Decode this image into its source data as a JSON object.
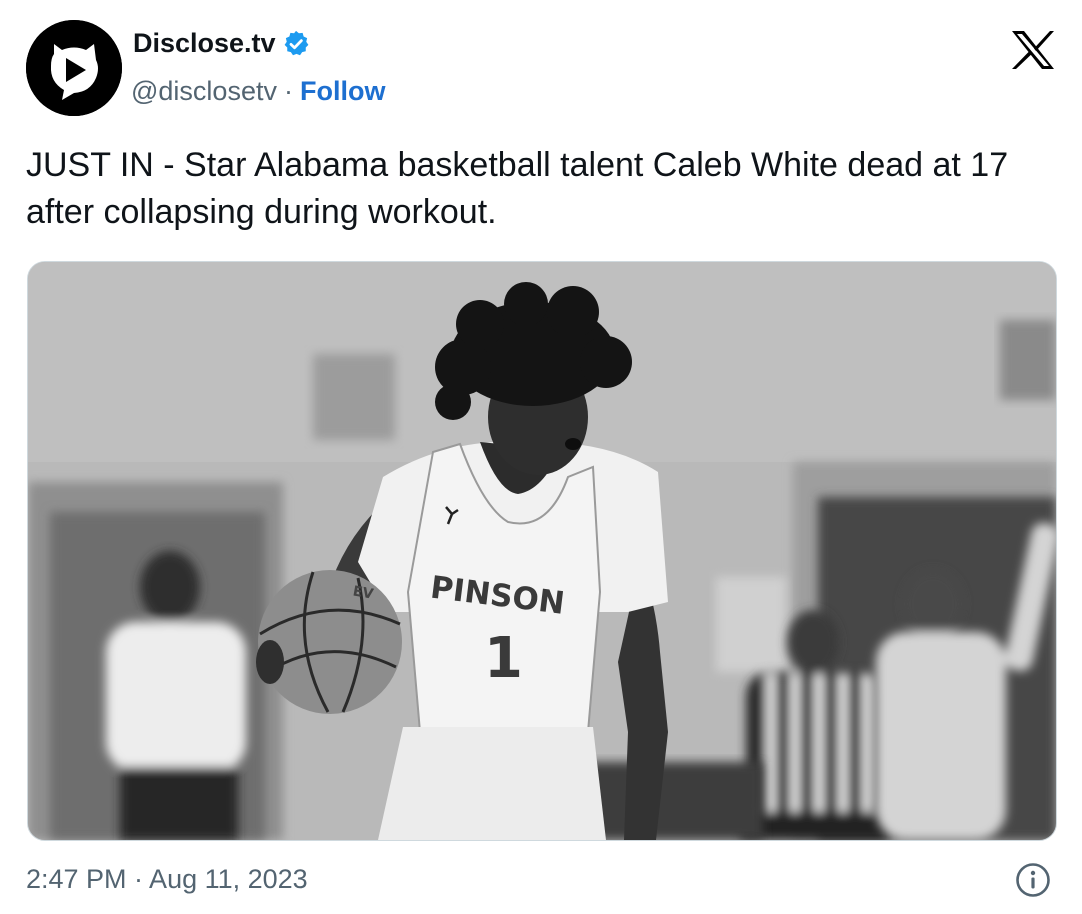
{
  "author": {
    "display_name": "Disclose.tv",
    "handle": "@disclosetv",
    "separator": "·",
    "follow_label": "Follow",
    "verified": true
  },
  "tweet": {
    "text": "JUST IN - Star Alabama basketball talent Caleb White dead at 17 after collapsing during workout.",
    "timestamp": "2:47 PM · Aug 11, 2023"
  },
  "media": {
    "jersey_text": "PINSON",
    "jersey_number": "1",
    "ball_text": "EV"
  },
  "icons": {
    "avatar": "play-speech-bubble-icon",
    "verified": "verified-badge-icon",
    "brand": "x-logo-icon",
    "info": "info-icon"
  },
  "colors": {
    "link": "#1d6fd0",
    "verified": "#1d9bf0",
    "secondary_text": "#536471",
    "primary_text": "#0f1419"
  }
}
